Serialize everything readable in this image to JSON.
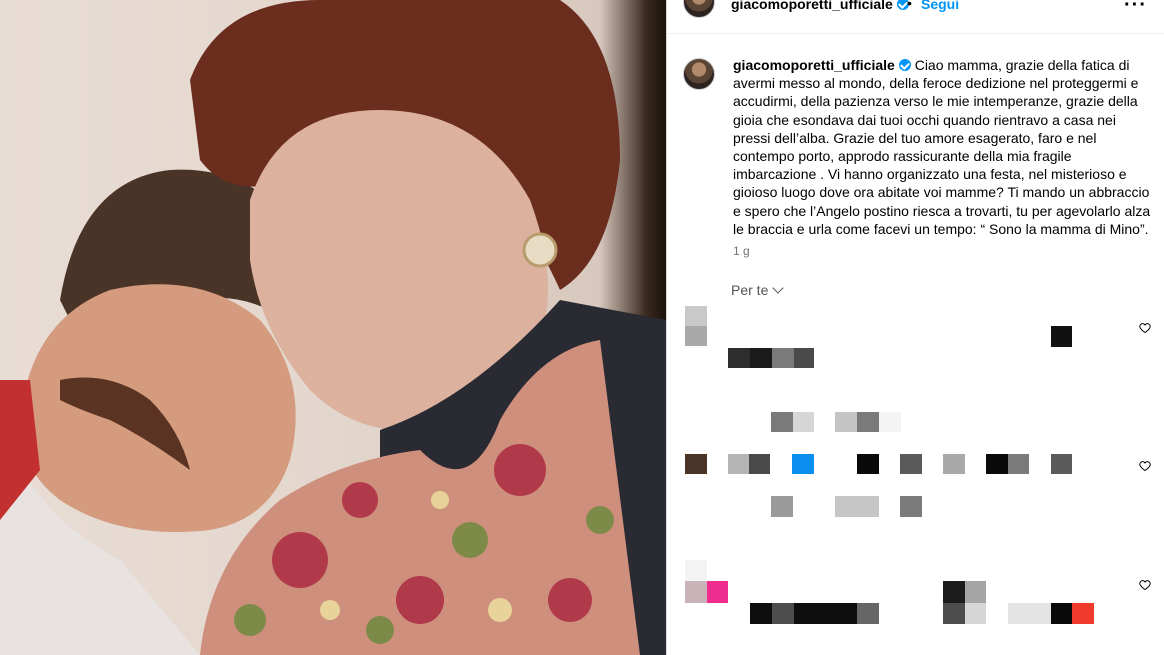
{
  "post": {
    "author": "giacomoporetti_ufficiale",
    "follow_label": "Segui",
    "separator": "•",
    "more_label": "···",
    "caption": "Ciao mamma, grazie della fatica di avermi messo al mondo, della feroce dedizione nel proteggermi e accudirmi, della pazienza verso le mie intemperanze, grazie della gioia che esondava dai tuoi occhi quando rientravo a casa nei pressi dell’alba. Grazie del tuo amore esagerato, faro e nel contempo porto, approdo rassicurante della mia fragile imbarcazione . Vi hanno organizzato una festa, nel misterioso e gioioso luogo dove ora abitate voi mamme? Ti mando un abbraccio e spero che l’Angelo postino riesca a trovarti, tu per agevolarlo alza le braccia e urla come facevi un tempo: “ Sono la mamma di Mino”.",
    "age": "1 g"
  },
  "comments": {
    "sort_label": "Per te",
    "items": [
      {
        "id": "comment-1",
        "redacted": true
      },
      {
        "id": "comment-2",
        "redacted": true
      },
      {
        "id": "comment-3",
        "redacted": true
      }
    ]
  },
  "icons": {
    "verified": "verified-badge-icon",
    "more": "more-options-icon",
    "heart": "heart-icon",
    "chevron": "chevron-down-icon"
  },
  "colors": {
    "accent": "#0095f6",
    "muted": "#737373",
    "border": "#dbdbdb"
  }
}
